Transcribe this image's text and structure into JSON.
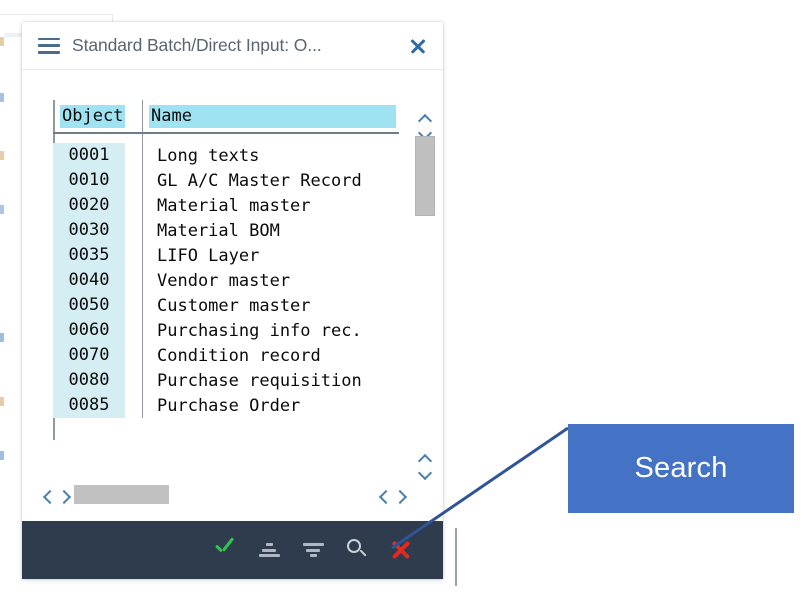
{
  "dialog": {
    "title": "Standard Batch/Direct Input: O...",
    "menu_icon": "hamburger-icon",
    "close_icon": "close-icon"
  },
  "table": {
    "columns": [
      "Object",
      "Name"
    ],
    "rows": [
      {
        "object": "0001",
        "name": "Long texts"
      },
      {
        "object": "0010",
        "name": "GL A/C Master Record"
      },
      {
        "object": "0020",
        "name": "Material master"
      },
      {
        "object": "0030",
        "name": "Material BOM"
      },
      {
        "object": "0035",
        "name": "LIFO Layer"
      },
      {
        "object": "0040",
        "name": "Vendor master"
      },
      {
        "object": "0050",
        "name": "Customer master"
      },
      {
        "object": "0060",
        "name": "Purchasing info rec."
      },
      {
        "object": "0070",
        "name": "Condition record"
      },
      {
        "object": "0080",
        "name": "Purchase requisition"
      },
      {
        "object": "0085",
        "name": "Purchase Order"
      }
    ]
  },
  "scrollbars": {
    "vertical_up_icon": "chevron-up-icon",
    "vertical_down_icon": "chevron-down-icon",
    "horizontal_left_icon": "chevron-left-icon",
    "horizontal_right_icon": "chevron-right-icon"
  },
  "toolbar": {
    "background": "#2e3c4d",
    "buttons": [
      {
        "name": "confirm-button",
        "icon": "check-icon",
        "label": "Continue"
      },
      {
        "name": "sort-ascending-button",
        "icon": "sort-ascending-icon",
        "label": "Sort in Ascending Order"
      },
      {
        "name": "sort-descending-button",
        "icon": "sort-descending-icon",
        "label": "Sort in Descending Order"
      },
      {
        "name": "search-button",
        "icon": "search-icon",
        "label": "Find"
      },
      {
        "name": "cancel-button",
        "icon": "close-x-icon",
        "label": "Cancel"
      }
    ]
  },
  "annotation": {
    "callout_label": "Search",
    "callout_color": "#4472c4",
    "leader_line_color": "#2f5597"
  }
}
